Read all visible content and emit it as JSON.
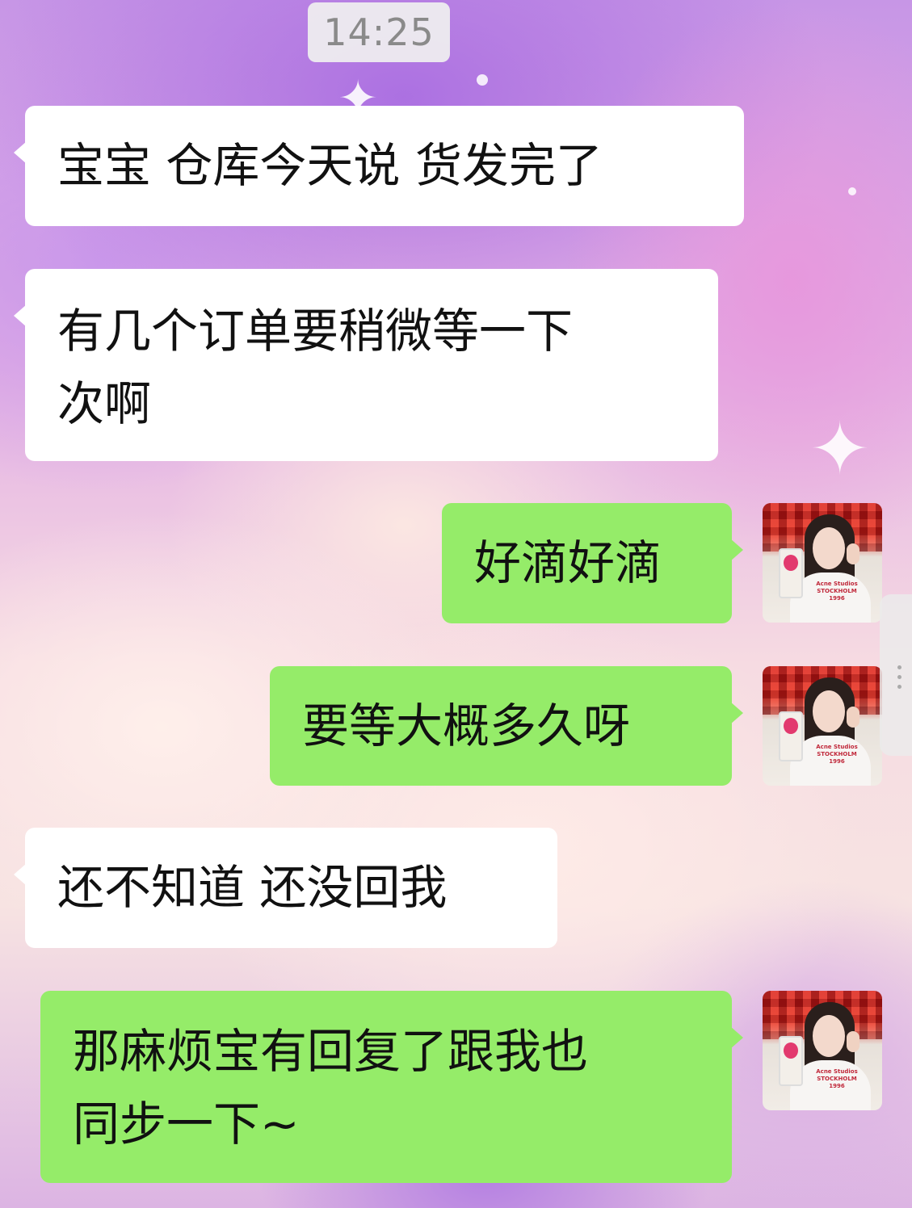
{
  "chat": {
    "timestamp": "14:25",
    "messages": [
      {
        "side": "left",
        "text": "宝宝 仓库今天说 货发完了"
      },
      {
        "side": "left",
        "text_line1": "有几个订单要稍微等一下",
        "text_line2": "次啊"
      },
      {
        "side": "right",
        "text": "好滴好滴"
      },
      {
        "side": "right",
        "text": "要等大概多久呀"
      },
      {
        "side": "left",
        "text": "还不知道 还没回我"
      },
      {
        "side": "right",
        "text_line1": "那麻烦宝有回复了跟我也",
        "text_line2": "同步一下~"
      }
    ],
    "avatar_shirt_text": [
      "Acne Studios",
      "STOCKHOLM",
      "1996"
    ]
  },
  "colors": {
    "incoming_bubble": "#ffffff",
    "outgoing_bubble": "#95ec69",
    "timestamp_text": "#8a8a8a"
  },
  "icons": [
    "user-avatar",
    "scroll-handle"
  ]
}
